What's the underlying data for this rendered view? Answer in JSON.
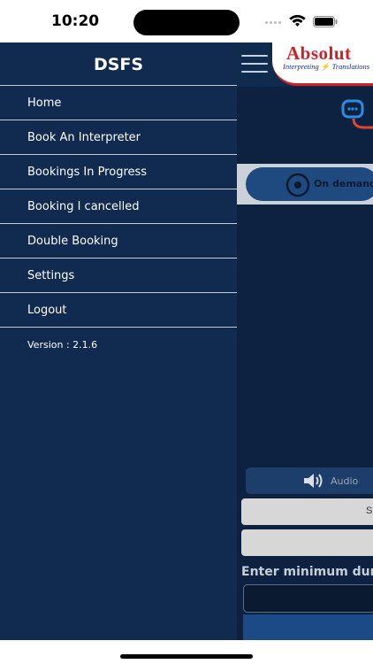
{
  "status_bar": {
    "time": "10:20"
  },
  "drawer": {
    "title": "DSFS",
    "items": [
      {
        "label": "Home"
      },
      {
        "label": "Book An Interpreter"
      },
      {
        "label": "Bookings In Progress"
      },
      {
        "label": "Booking I cancelled"
      },
      {
        "label": "Double Booking"
      },
      {
        "label": "Settings"
      },
      {
        "label": "Logout"
      }
    ],
    "version": "Version : 2.1.6"
  },
  "background_app": {
    "logo": {
      "title": "Absolut",
      "subtitle": "Interpreting ⚡ Translations"
    },
    "on_demand_label": "On demand",
    "audio_label": "Audio",
    "field_1_text": "S",
    "min_duration_label": "Enter minimum dura"
  },
  "colors": {
    "drawer_bg": "#102b4f",
    "app_bg": "#0c2240",
    "logo_red": "#d21f26",
    "button_blue": "#1f4a80"
  },
  "icons": {
    "menu": "hamburger-icon",
    "chat": "chat-icon",
    "target": "target-icon",
    "speaker": "speaker-icon",
    "wifi": "wifi-icon",
    "battery": "battery-icon"
  }
}
